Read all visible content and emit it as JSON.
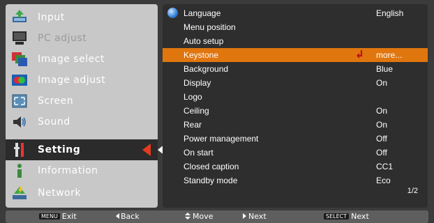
{
  "left_menu": {
    "items": [
      {
        "label": "Input",
        "icon": "input-icon"
      },
      {
        "label": "PC adjust",
        "icon": "pc-adjust-icon"
      },
      {
        "label": "Image select",
        "icon": "image-select-icon"
      },
      {
        "label": "Image adjust",
        "icon": "image-adjust-icon"
      },
      {
        "label": "Screen",
        "icon": "screen-icon"
      },
      {
        "label": "Sound",
        "icon": "sound-icon"
      },
      {
        "label": "Setting",
        "icon": "setting-icon"
      },
      {
        "label": "Information",
        "icon": "information-icon"
      },
      {
        "label": "Network",
        "icon": "network-icon"
      }
    ],
    "selected": "Setting"
  },
  "settings": {
    "rows": [
      {
        "label": "Language",
        "value": "English"
      },
      {
        "label": "Menu position",
        "value": ""
      },
      {
        "label": "Auto setup",
        "value": ""
      },
      {
        "label": "Keystone",
        "value": "more..."
      },
      {
        "label": "Background",
        "value": "Blue"
      },
      {
        "label": "Display",
        "value": "On"
      },
      {
        "label": "Logo",
        "value": ""
      },
      {
        "label": "Ceiling",
        "value": "On"
      },
      {
        "label": "Rear",
        "value": "On"
      },
      {
        "label": "Power management",
        "value": "Off"
      },
      {
        "label": "On start",
        "value": "Off"
      },
      {
        "label": "Closed caption",
        "value": "CC1"
      },
      {
        "label": "Standby mode",
        "value": "Eco"
      }
    ],
    "highlighted": "Keystone",
    "page": "1/2"
  },
  "footer": {
    "exit_key": "MENU",
    "exit_label": "Exit",
    "back_label": "Back",
    "move_label": "Move",
    "next_label": "Next",
    "select_key": "SELECT",
    "select_next_label": "Next"
  },
  "colors": {
    "highlight": "#e0760e",
    "selected_arrow": "#e53a1e"
  }
}
